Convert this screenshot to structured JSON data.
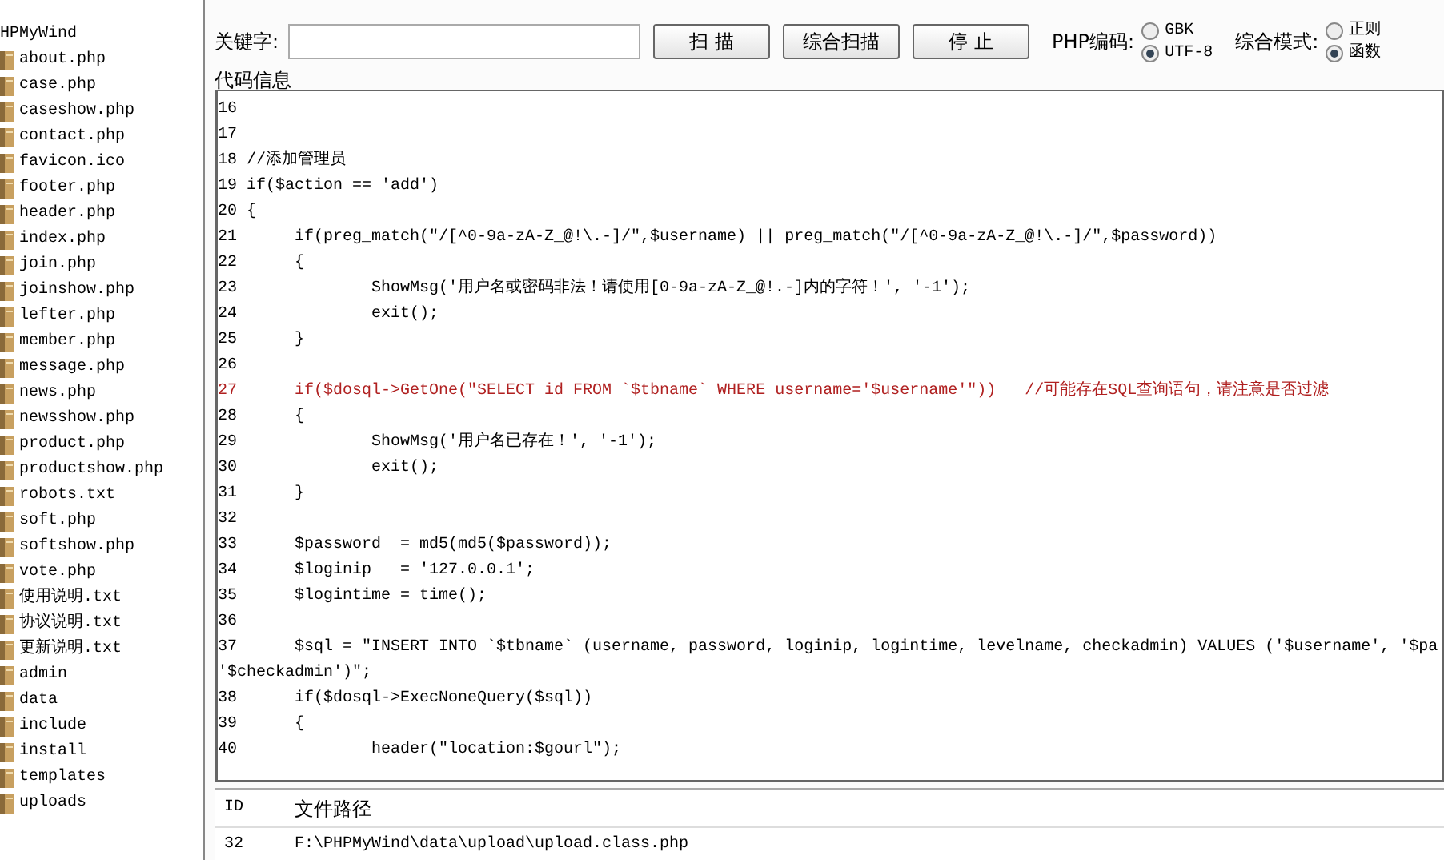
{
  "tree": {
    "label": "HPMyWind",
    "children": [
      {
        "label": "about.php"
      },
      {
        "label": "case.php"
      },
      {
        "label": "caseshow.php"
      },
      {
        "label": "contact.php"
      },
      {
        "label": "favicon.ico"
      },
      {
        "label": "footer.php"
      },
      {
        "label": "header.php"
      },
      {
        "label": "index.php"
      },
      {
        "label": "join.php"
      },
      {
        "label": "joinshow.php"
      },
      {
        "label": "lefter.php"
      },
      {
        "label": "member.php"
      },
      {
        "label": "message.php"
      },
      {
        "label": "news.php"
      },
      {
        "label": "newsshow.php"
      },
      {
        "label": "product.php"
      },
      {
        "label": "productshow.php"
      },
      {
        "label": "robots.txt"
      },
      {
        "label": "soft.php"
      },
      {
        "label": "softshow.php"
      },
      {
        "label": "vote.php"
      },
      {
        "label": "使用说明.txt"
      },
      {
        "label": "协议说明.txt"
      },
      {
        "label": "更新说明.txt"
      },
      {
        "label": "admin"
      },
      {
        "label": "data"
      },
      {
        "label": "include"
      },
      {
        "label": "install"
      },
      {
        "label": "templates"
      },
      {
        "label": "uploads"
      }
    ]
  },
  "toolbar": {
    "keyword_label": "关键字:",
    "buttons": [
      "扫 描",
      "综合扫描",
      "停 止"
    ],
    "radio_groups": [
      {
        "label": "PHP编码:",
        "options": [
          {
            "label": "GBK",
            "selected": false
          },
          {
            "label": "UTF-8",
            "selected": true
          }
        ]
      },
      {
        "label": "综合模式:",
        "options": [
          {
            "label": "正则",
            "selected": false
          },
          {
            "label": "函数",
            "selected": true
          }
        ]
      }
    ]
  },
  "code_panel": {
    "title": "代码信息",
    "lines": [
      {
        "text": "16",
        "highlighted": false
      },
      {
        "text": "17",
        "highlighted": false
      },
      {
        "text": "18 //添加管理员",
        "highlighted": false
      },
      {
        "text": "19 if($action == 'add')",
        "highlighted": false
      },
      {
        "text": "20 {",
        "highlighted": false
      },
      {
        "text": "21\tif(preg_match(\"/[^0-9a-zA-Z_@!\\.-]/\",$username) || preg_match(\"/[^0-9a-zA-Z_@!\\.-]/\",$password))",
        "highlighted": false
      },
      {
        "text": "22\t{",
        "highlighted": false
      },
      {
        "text": "23\t\tShowMsg('用户名或密码非法！请使用[0-9a-zA-Z_@!.-]内的字符！', '-1');",
        "highlighted": false
      },
      {
        "text": "24\t\texit();",
        "highlighted": false
      },
      {
        "text": "25\t}",
        "highlighted": false
      },
      {
        "text": "26",
        "highlighted": false
      },
      {
        "text": "27\tif($dosql->GetOne(\"SELECT id FROM `$tbname` WHERE username='$username'\"))   //可能存在SQL查询语句，请注意是否过滤",
        "highlighted": true
      },
      {
        "text": "28\t{",
        "highlighted": false
      },
      {
        "text": "29\t\tShowMsg('用户名已存在！', '-1');",
        "highlighted": false
      },
      {
        "text": "30\t\texit();",
        "highlighted": false
      },
      {
        "text": "31\t}",
        "highlighted": false
      },
      {
        "text": "32",
        "highlighted": false
      },
      {
        "text": "33\t$password  = md5(md5($password));",
        "highlighted": false
      },
      {
        "text": "34\t$loginip   = '127.0.0.1';",
        "highlighted": false
      },
      {
        "text": "35\t$logintime = time();",
        "highlighted": false
      },
      {
        "text": "36",
        "highlighted": false
      },
      {
        "text": "37\t$sql = \"INSERT INTO `$tbname` (username, password, loginip, logintime, levelname, checkadmin) VALUES ('$username', '$pa",
        "highlighted": false
      },
      {
        "text": "'$checkadmin')\";",
        "highlighted": false
      },
      {
        "text": "38\tif($dosql->ExecNoneQuery($sql))",
        "highlighted": false
      },
      {
        "text": "39\t{",
        "highlighted": false
      },
      {
        "text": "40\t\theader(\"location:$gourl\");",
        "highlighted": false
      }
    ]
  },
  "results": {
    "columns": [
      "ID",
      "文件路径"
    ],
    "rows": [
      [
        "32",
        "F:\\PHPMyWind\\data\\upload\\upload.class.php"
      ]
    ]
  }
}
